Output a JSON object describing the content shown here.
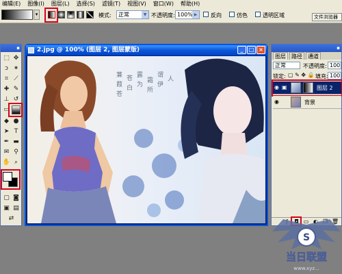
{
  "menu": {
    "items": [
      {
        "label": "编辑(E)"
      },
      {
        "label": "图像(I)"
      },
      {
        "label": "图层(L)"
      },
      {
        "label": "选择(S)"
      },
      {
        "label": "滤镜(T)"
      },
      {
        "label": "视图(V)"
      },
      {
        "label": "窗口(W)"
      },
      {
        "label": "帮助(H)"
      }
    ]
  },
  "options": {
    "mode_label": "模式:",
    "mode_value": "正常",
    "opacity_label": "不透明度:",
    "opacity_value": "100%",
    "reverse_label": "反向",
    "dither_label": "仿色",
    "transparency_label": "透明区域",
    "doc_button": "文件浏览器"
  },
  "document": {
    "title": "2.jpg @ 100% (图层 2, 图层蒙版)",
    "poem_lines": [
      "蒹",
      "葭",
      "苍",
      "苍",
      "白",
      "露",
      "为",
      "霜",
      "所",
      "谓",
      "伊",
      "人"
    ]
  },
  "layers_panel": {
    "tabs": [
      {
        "label": "图层"
      },
      {
        "label": "路径"
      },
      {
        "label": "通道"
      }
    ],
    "blend_mode": "正常",
    "opacity_label": "不透明度:",
    "opacity_value": "100",
    "lock_label": "锁定:",
    "fill_label": "填充:",
    "fill_value": "100",
    "layers": [
      {
        "name": "图层 2"
      },
      {
        "name": "背景"
      }
    ]
  },
  "watermark": {
    "brand_text": "当日联盟",
    "url_text": "www.xyz..."
  },
  "colors": {
    "highlight_red": "#d6001c",
    "xp_blue": "#0054e3",
    "selected_layer": "#0a246a"
  }
}
